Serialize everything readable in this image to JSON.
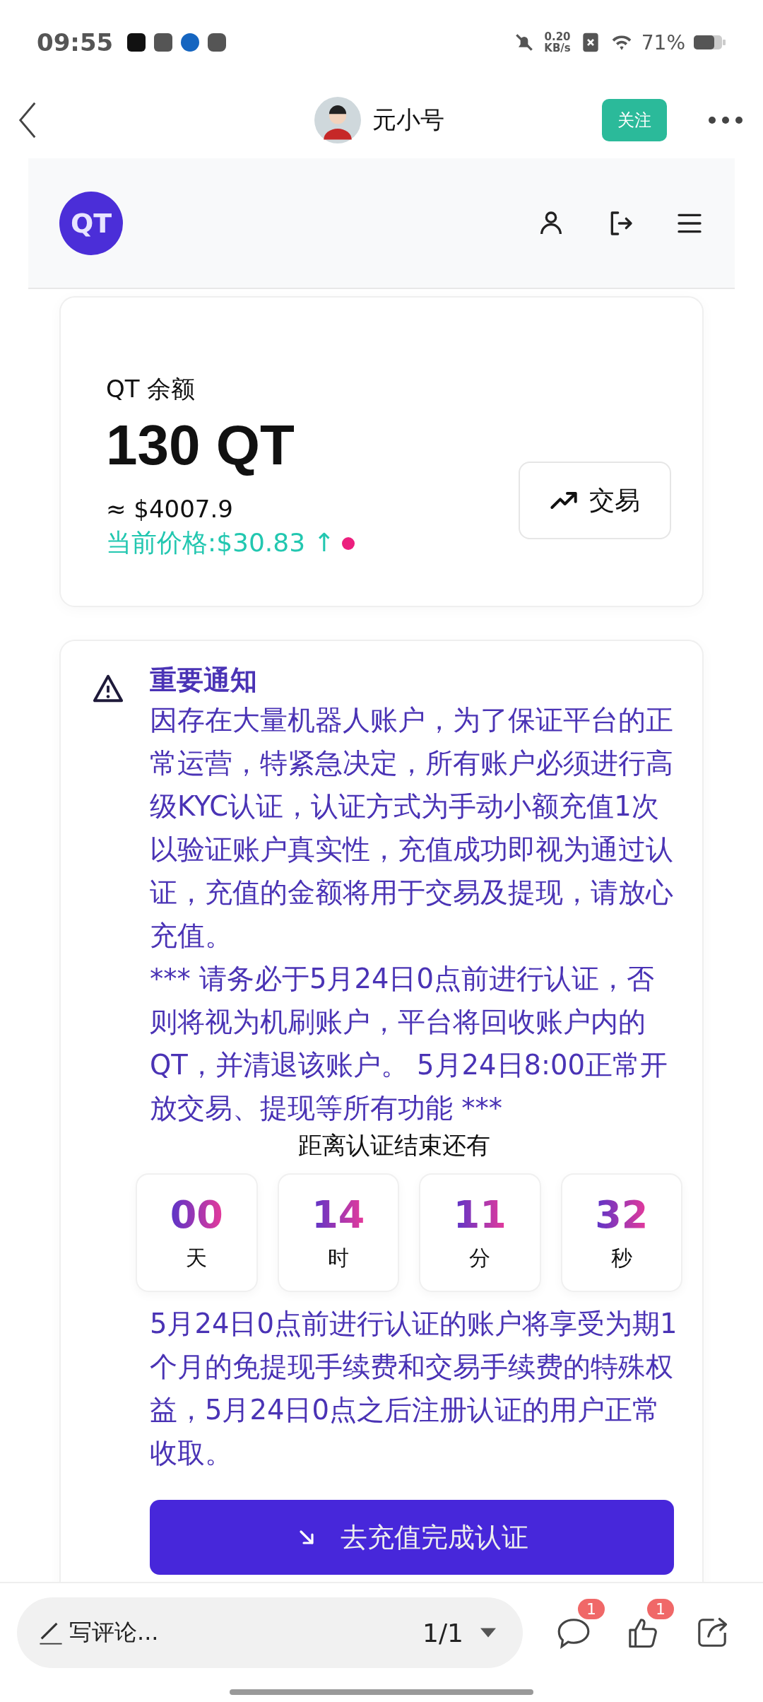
{
  "status_bar": {
    "time": "09:55",
    "speed_value": "0.20",
    "speed_unit": "KB/s",
    "battery": "71%"
  },
  "nav_bar": {
    "title": "元小号",
    "follow_button": "关注"
  },
  "site_header": {
    "logo": "QT"
  },
  "balance_card": {
    "label": "QT 余额",
    "amount": "130 QT",
    "usd_value": "≈ $4007.9",
    "price": "当前价格:$30.83 ↑",
    "trade_button": "交易"
  },
  "notice": {
    "title": "重要通知",
    "paragraphs": [
      "因存在大量机器人账户，为了保证平台的正常运营，特紧急决定，所有账户必须进行高级KYC认证，认证方式为手动小额充值1次以验证账户真实性，充值成功即视为通过认证，充值的金额将用于交易及提现，请放心充值。",
      "*** 请务必于5月24日0点前进行认证，否则将视为机刷账户，平台将回收账户内的QT，并清退该账户。 5月24日8:00正常开放交易、提现等所有功能 ***"
    ],
    "countdown_label": "距离认证结束还有",
    "countdown": [
      {
        "value": "00",
        "unit": "天"
      },
      {
        "value": "14",
        "unit": "时"
      },
      {
        "value": "11",
        "unit": "分"
      },
      {
        "value": "32",
        "unit": "秒"
      }
    ],
    "footer_text": "5月24日0点前进行认证的账户将享受为期1个月的免提现手续费和交易手续费的特殊权益，5月24日0点之后注册认证的用户正常收取。",
    "cta_button": "去充值完成认证"
  },
  "bottom_bar": {
    "comment_placeholder": "写评论...",
    "page_indicator": "1/1",
    "comment_count": "1",
    "like_count": "1"
  }
}
